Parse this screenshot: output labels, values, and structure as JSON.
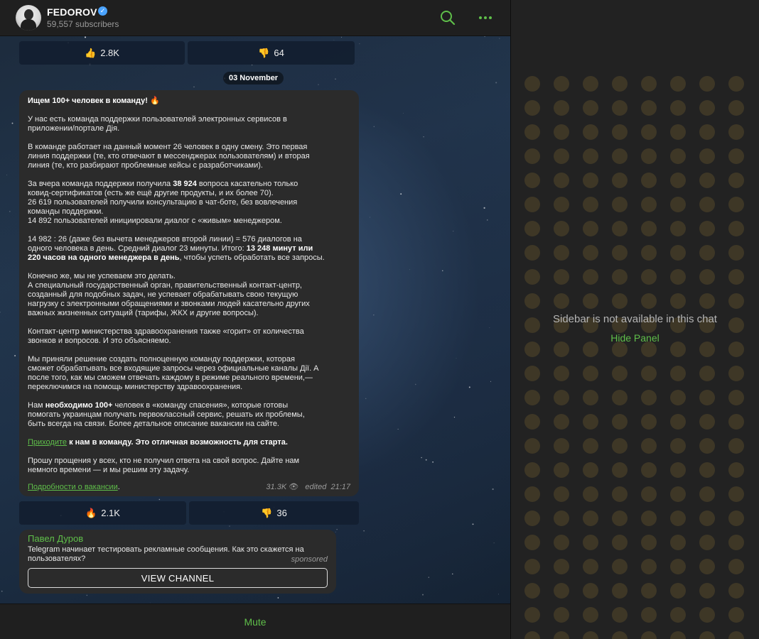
{
  "header": {
    "channel_name": "FEDOROV",
    "subscribers": "59,557 subscribers",
    "verified_glyph": "✓",
    "icons": [
      "search-icon",
      "more-icon"
    ]
  },
  "prev_reactions": [
    {
      "emoji": "👍",
      "count": "2.8K"
    },
    {
      "emoji": "👎",
      "count": "64"
    }
  ],
  "date_badge": "03 November",
  "post": {
    "title": "Ищем 100+ человек в команду! 🔥",
    "p1": [
      "У нас есть команда поддержки пользователей электронных сервисов в",
      "приложении/портале Дія."
    ],
    "p2": [
      "В команде работает на данный момент 26 человек в одну смену. Это первая",
      "линия поддержки (те, кто отвечают в мессенджерах пользователям) и вторая",
      "линия (те, кто разбирают проблемные кейсы с разработчиками)."
    ],
    "p3a_pre": "За вчера команда поддержки получила ",
    "p3a_bold": "38 924",
    "p3a_post": " вопроса касательно только",
    "p3b": "ковид-сертификатов (есть же ещё другие продукты, и их более 70).",
    "p3c": "26 619 пользователей получили консультацию в чат-боте, без вовлечения",
    "p3d": "команды поддержки.",
    "p3e": "14 892 пользователей инициировали диалог с «живым» менеджером.",
    "p4a": "14 982 : 26 (даже без вычета менеджеров второй линии) = 576 диалогов на",
    "p4b_pre": "одного человека в день. Средний диалог 23 минуты. Итого: ",
    "p4b_bold": "13 248 минут или",
    "p4c_bold": "220 часов на одного менеджера в день",
    "p4c_post": ", чтобы успеть обработать все запросы.",
    "p5": [
      "Конечно же, мы не успеваем это делать.",
      "А специальный государственный орган, правительственный контакт-центр,",
      "созданный для подобных задач, не успевает обрабатывать свою текущую",
      "нагрузку с  электронными обращениями и звонками людей касательно других",
      "важных жизненных ситуаций (тарифы, ЖКХ и другие вопросы)."
    ],
    "p6": [
      "Контакт-центр министерства здравоохранения также «горит» от количества",
      "звонков и вопросов. И это объясняемо."
    ],
    "p7": [
      "Мы приняли решение создать полноценную команду поддержки, которая",
      "сможет обрабатывать все входящие запросы через официальные каналы Дії. А",
      "после того, как мы сможем отвечать каждому в режиме реального времени,—",
      "переключимся на помощь министерству здравоохранения."
    ],
    "p8a_pre": "Нам ",
    "p8a_bold": "необходимо 100+",
    "p8a_post": " человек в «команду спасения», которые готовы",
    "p8b": "помогать украинцам получать первоклассный сервис, решать их проблемы,",
    "p8c": "быть всегда на связи. Более детальное описание вакансии на сайте.",
    "p9_link": "Приходите",
    "p9_bold": " к нам в команду. Это отличная возможность для старта.",
    "p10": [
      "Прошу прощения у всех, кто не получил ответа на свой вопрос. Дайте нам",
      "немного времени — и мы решим эту задачу."
    ],
    "footer_link": "Подробности о вакансии",
    "footer_dot": ".",
    "views": "31.3K",
    "views_icon": "👁",
    "edited": "edited",
    "time": "21:17"
  },
  "post_reactions": [
    {
      "emoji": "🔥",
      "count": "2.1K"
    },
    {
      "emoji": "👎",
      "count": "36"
    }
  ],
  "ad": {
    "author": "Павел Дуров",
    "text": "Telegram начинает тестировать рекламные сообщения. Как это скажется на пользователях?",
    "sponsored": "sponsored",
    "button": "VIEW CHANNEL"
  },
  "bottom": {
    "mute": "Mute"
  },
  "sidebar": {
    "message": "Sidebar is not available in this chat",
    "hide_panel": "Hide Panel"
  },
  "colors": {
    "accent": "#5fbf4a",
    "bubble": "#2b2b2b",
    "header": "#1f1f1f",
    "sidebar": "#222222"
  }
}
